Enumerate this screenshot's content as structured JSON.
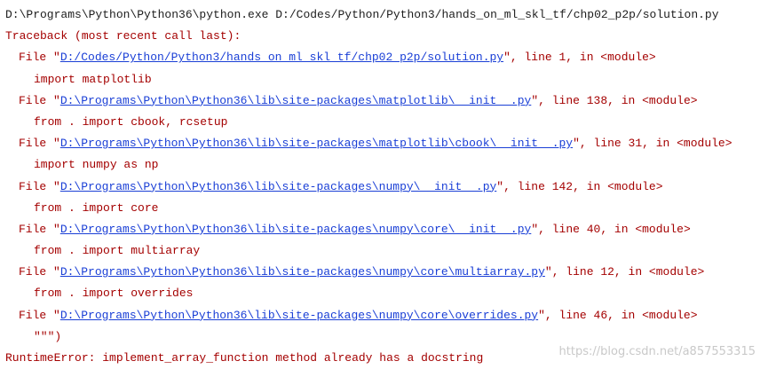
{
  "console": {
    "command": "D:\\Programs\\Python\\Python36\\python.exe D:/Codes/Python/Python3/hands_on_ml_skl_tf/chp02_p2p/solution.py",
    "traceback_header": "Traceback (most recent call last):",
    "frames": [
      {
        "prefix": "File \"",
        "path": "D:/Codes/Python/Python3/hands_on_ml_skl_tf/chp02_p2p/solution.py",
        "suffix": "\", line 1, in <module>",
        "code": "import matplotlib"
      },
      {
        "prefix": "File \"",
        "path": "D:\\Programs\\Python\\Python36\\lib\\site-packages\\matplotlib\\__init__.py",
        "suffix": "\", line 138, in <module>",
        "code": "from . import cbook, rcsetup"
      },
      {
        "prefix": "File \"",
        "path": "D:\\Programs\\Python\\Python36\\lib\\site-packages\\matplotlib\\cbook\\__init__.py",
        "suffix": "\", line 31, in <module>",
        "code": "import numpy as np"
      },
      {
        "prefix": "File \"",
        "path": "D:\\Programs\\Python\\Python36\\lib\\site-packages\\numpy\\__init__.py",
        "suffix": "\", line 142, in <module>",
        "code": "from . import core"
      },
      {
        "prefix": "File \"",
        "path": "D:\\Programs\\Python\\Python36\\lib\\site-packages\\numpy\\core\\__init__.py",
        "suffix": "\", line 40, in <module>",
        "code": "from . import multiarray"
      },
      {
        "prefix": "File \"",
        "path": "D:\\Programs\\Python\\Python36\\lib\\site-packages\\numpy\\core\\multiarray.py",
        "suffix": "\", line 12, in <module>",
        "code": "from . import overrides"
      },
      {
        "prefix": "File \"",
        "path": "D:\\Programs\\Python\\Python36\\lib\\site-packages\\numpy\\core\\overrides.py",
        "suffix": "\", line 46, in <module>",
        "code": "\"\"\")"
      }
    ],
    "error": "RuntimeError: implement_array_function method already has a docstring"
  },
  "watermark": "https://blog.csdn.net/a857553315",
  "colors": {
    "command_text": "#1d1d1d",
    "error_text": "#a40000",
    "link": "#1a3fd6",
    "watermark": "#c9c9c9",
    "background": "#ffffff"
  }
}
